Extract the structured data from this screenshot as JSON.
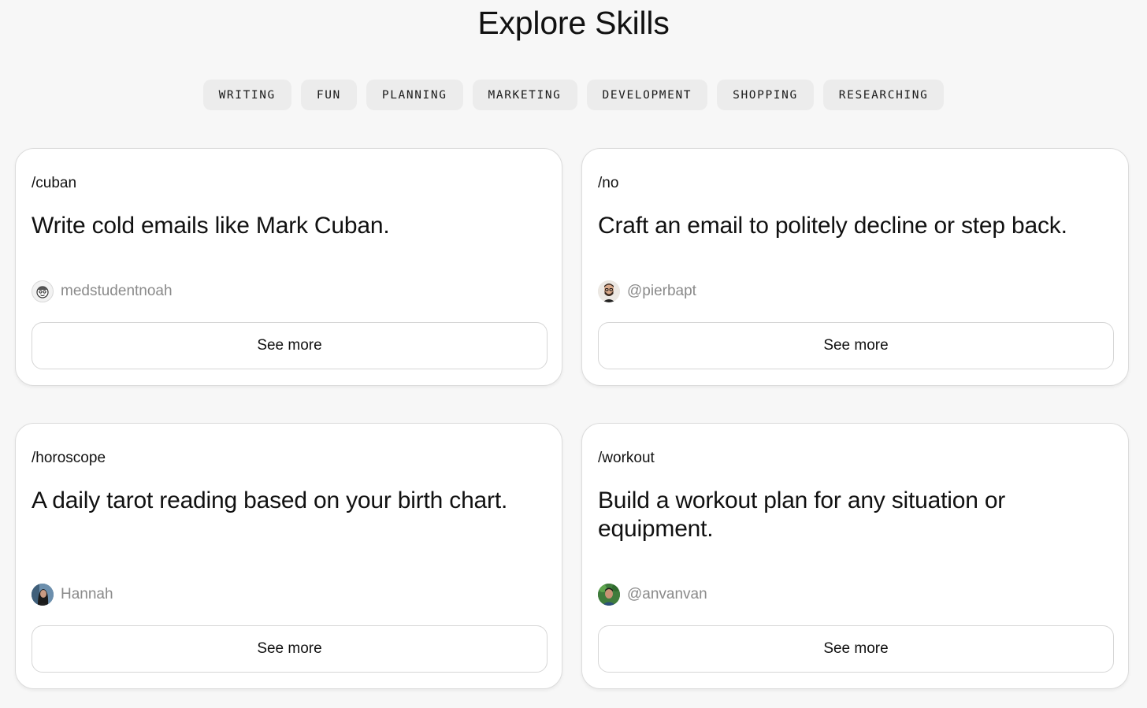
{
  "page": {
    "title": "Explore Skills"
  },
  "filters": [
    {
      "label": "WRITING"
    },
    {
      "label": "FUN"
    },
    {
      "label": "PLANNING"
    },
    {
      "label": "MARKETING"
    },
    {
      "label": "DEVELOPMENT"
    },
    {
      "label": "SHOPPING"
    },
    {
      "label": "RESEARCHING"
    }
  ],
  "skills": [
    {
      "command": "/cuban",
      "description": "Write cold emails like Mark Cuban.",
      "author": "medstudentnoah",
      "avatar_icon": "cartoon-face-avatar",
      "button_label": "See more"
    },
    {
      "command": "/no",
      "description": "Craft an email to politely decline or step back.",
      "author": "@pierbapt",
      "avatar_icon": "bearded-man-avatar",
      "button_label": "See more"
    },
    {
      "command": "/horoscope",
      "description": "A daily tarot reading based on your birth chart.",
      "author": "Hannah",
      "avatar_icon": "woman-photo-avatar",
      "button_label": "See more"
    },
    {
      "command": "/workout",
      "description": "Build a workout plan for any situation or equipment.",
      "author": "@anvanvan",
      "avatar_icon": "man-outdoor-photo-avatar",
      "button_label": "See more"
    }
  ],
  "colors": {
    "background": "#f7f7f7",
    "chip_background": "#ececec",
    "card_background": "#ffffff",
    "muted_text": "#8a8a8a"
  }
}
